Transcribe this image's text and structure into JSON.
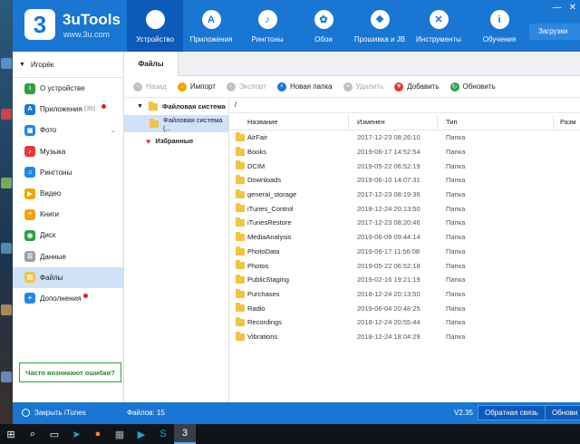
{
  "app": {
    "name": "3uTools",
    "site": "www.3u.com",
    "logo_char": "3"
  },
  "nav": [
    {
      "label": "Устройство",
      "icon": "apple-icon",
      "glyph": ""
    },
    {
      "label": "Приложения",
      "icon": "app-store-icon",
      "glyph": "A"
    },
    {
      "label": "Рингтоны",
      "icon": "bell-icon",
      "glyph": "♪"
    },
    {
      "label": "Обои",
      "icon": "flower-icon",
      "glyph": "✿"
    },
    {
      "label": "Прошивка и JB",
      "icon": "box-icon",
      "glyph": "❖"
    },
    {
      "label": "Инструменты",
      "icon": "tools-icon",
      "glyph": "✕"
    },
    {
      "label": "Обучения",
      "icon": "info-icon",
      "glyph": "i"
    }
  ],
  "downloads_label": "Загрузки",
  "sidebar": {
    "user": "Игорёк",
    "items": [
      {
        "label": "О устройстве",
        "color": "#2ea043",
        "glyph": "i"
      },
      {
        "label": "Приложения",
        "count": "(35)",
        "color": "#1976d2",
        "glyph": "A",
        "dot": true
      },
      {
        "label": "Фото",
        "color": "#1e88e5",
        "glyph": "▣",
        "chevron": "⌄"
      },
      {
        "label": "Музыка",
        "color": "#e53935",
        "glyph": "♪"
      },
      {
        "label": "Рингтоны",
        "color": "#1e88e5",
        "glyph": "♫"
      },
      {
        "label": "Видео",
        "color": "#f4a300",
        "glyph": "▶"
      },
      {
        "label": "Книги",
        "color": "#f4a300",
        "glyph": "≡"
      },
      {
        "label": "Диск",
        "color": "#2ea043",
        "glyph": "◉"
      },
      {
        "label": "Данные",
        "color": "#9e9e9e",
        "glyph": "☰"
      },
      {
        "label": "Файлы",
        "color": "#f5c342",
        "glyph": "▤",
        "active": true
      },
      {
        "label": "Дополнения",
        "color": "#1e88e5",
        "glyph": "+",
        "dot": true
      }
    ],
    "help": "Часто возникают ошибки?"
  },
  "tab": "Файлы",
  "toolbar": [
    {
      "label": "Назад",
      "disabled": true,
      "color": "#c0c0c0",
      "glyph": "‹"
    },
    {
      "label": "Импорт",
      "disabled": false,
      "color": "#f4a300",
      "glyph": "↓"
    },
    {
      "label": "Экспорт",
      "disabled": true,
      "color": "#c0c0c0",
      "glyph": "↑"
    },
    {
      "label": "Новая папка",
      "disabled": false,
      "color": "#1976d2",
      "glyph": "+"
    },
    {
      "label": "Удалить",
      "disabled": true,
      "color": "#c0c0c0",
      "glyph": "×"
    },
    {
      "label": "Добавить",
      "disabled": false,
      "color": "#e53935",
      "glyph": "♥"
    },
    {
      "label": "Обновить",
      "disabled": false,
      "color": "#2ea043",
      "glyph": "↻"
    }
  ],
  "tree": {
    "root": "Файловая система",
    "child": "Файловая система (...",
    "favorites": "Избранные"
  },
  "path": "/",
  "columns": {
    "name": "Название",
    "date": "Изменен",
    "type": "Тип",
    "size": "Разм"
  },
  "files": [
    {
      "name": "AirFair",
      "date": "2017-12-23 08:26:10",
      "type": "Папка"
    },
    {
      "name": "Books",
      "date": "2019-06-17 14:52:54",
      "type": "Папка"
    },
    {
      "name": "DCIM",
      "date": "2019-05-22 06:52:19",
      "type": "Папка"
    },
    {
      "name": "Downloads",
      "date": "2019-06-10 14:07:31",
      "type": "Папка"
    },
    {
      "name": "general_storage",
      "date": "2017-12-23 08:19:36",
      "type": "Папка"
    },
    {
      "name": "iTunes_Control",
      "date": "2018-12-24 20:13:50",
      "type": "Папка"
    },
    {
      "name": "iTunesRestore",
      "date": "2017-12-23 08:20:46",
      "type": "Папка"
    },
    {
      "name": "MediaAnalysis",
      "date": "2019-06-09 09:44:14",
      "type": "Папка"
    },
    {
      "name": "PhotoData",
      "date": "2019-06-17 11:56:08",
      "type": "Папка"
    },
    {
      "name": "Photos",
      "date": "2019-05-22 06:52:18",
      "type": "Папка"
    },
    {
      "name": "PublicStaging",
      "date": "2019-02-16 19:21:19",
      "type": "Папка"
    },
    {
      "name": "Purchases",
      "date": "2018-12-24 20:13:50",
      "type": "Папка"
    },
    {
      "name": "Radio",
      "date": "2019-06-04 20:48:25",
      "type": "Папка"
    },
    {
      "name": "Recordings",
      "date": "2018-12-24 20:55:44",
      "type": "Папка"
    },
    {
      "name": "Vibrations",
      "date": "2018-12-24 18:04:29",
      "type": "Папка"
    }
  ],
  "status": {
    "itunes": "Закрыть iTunes",
    "file_count": "Файлов: 15",
    "version": "V2.35",
    "feedback": "Обратная связь",
    "update": "Обнови"
  }
}
